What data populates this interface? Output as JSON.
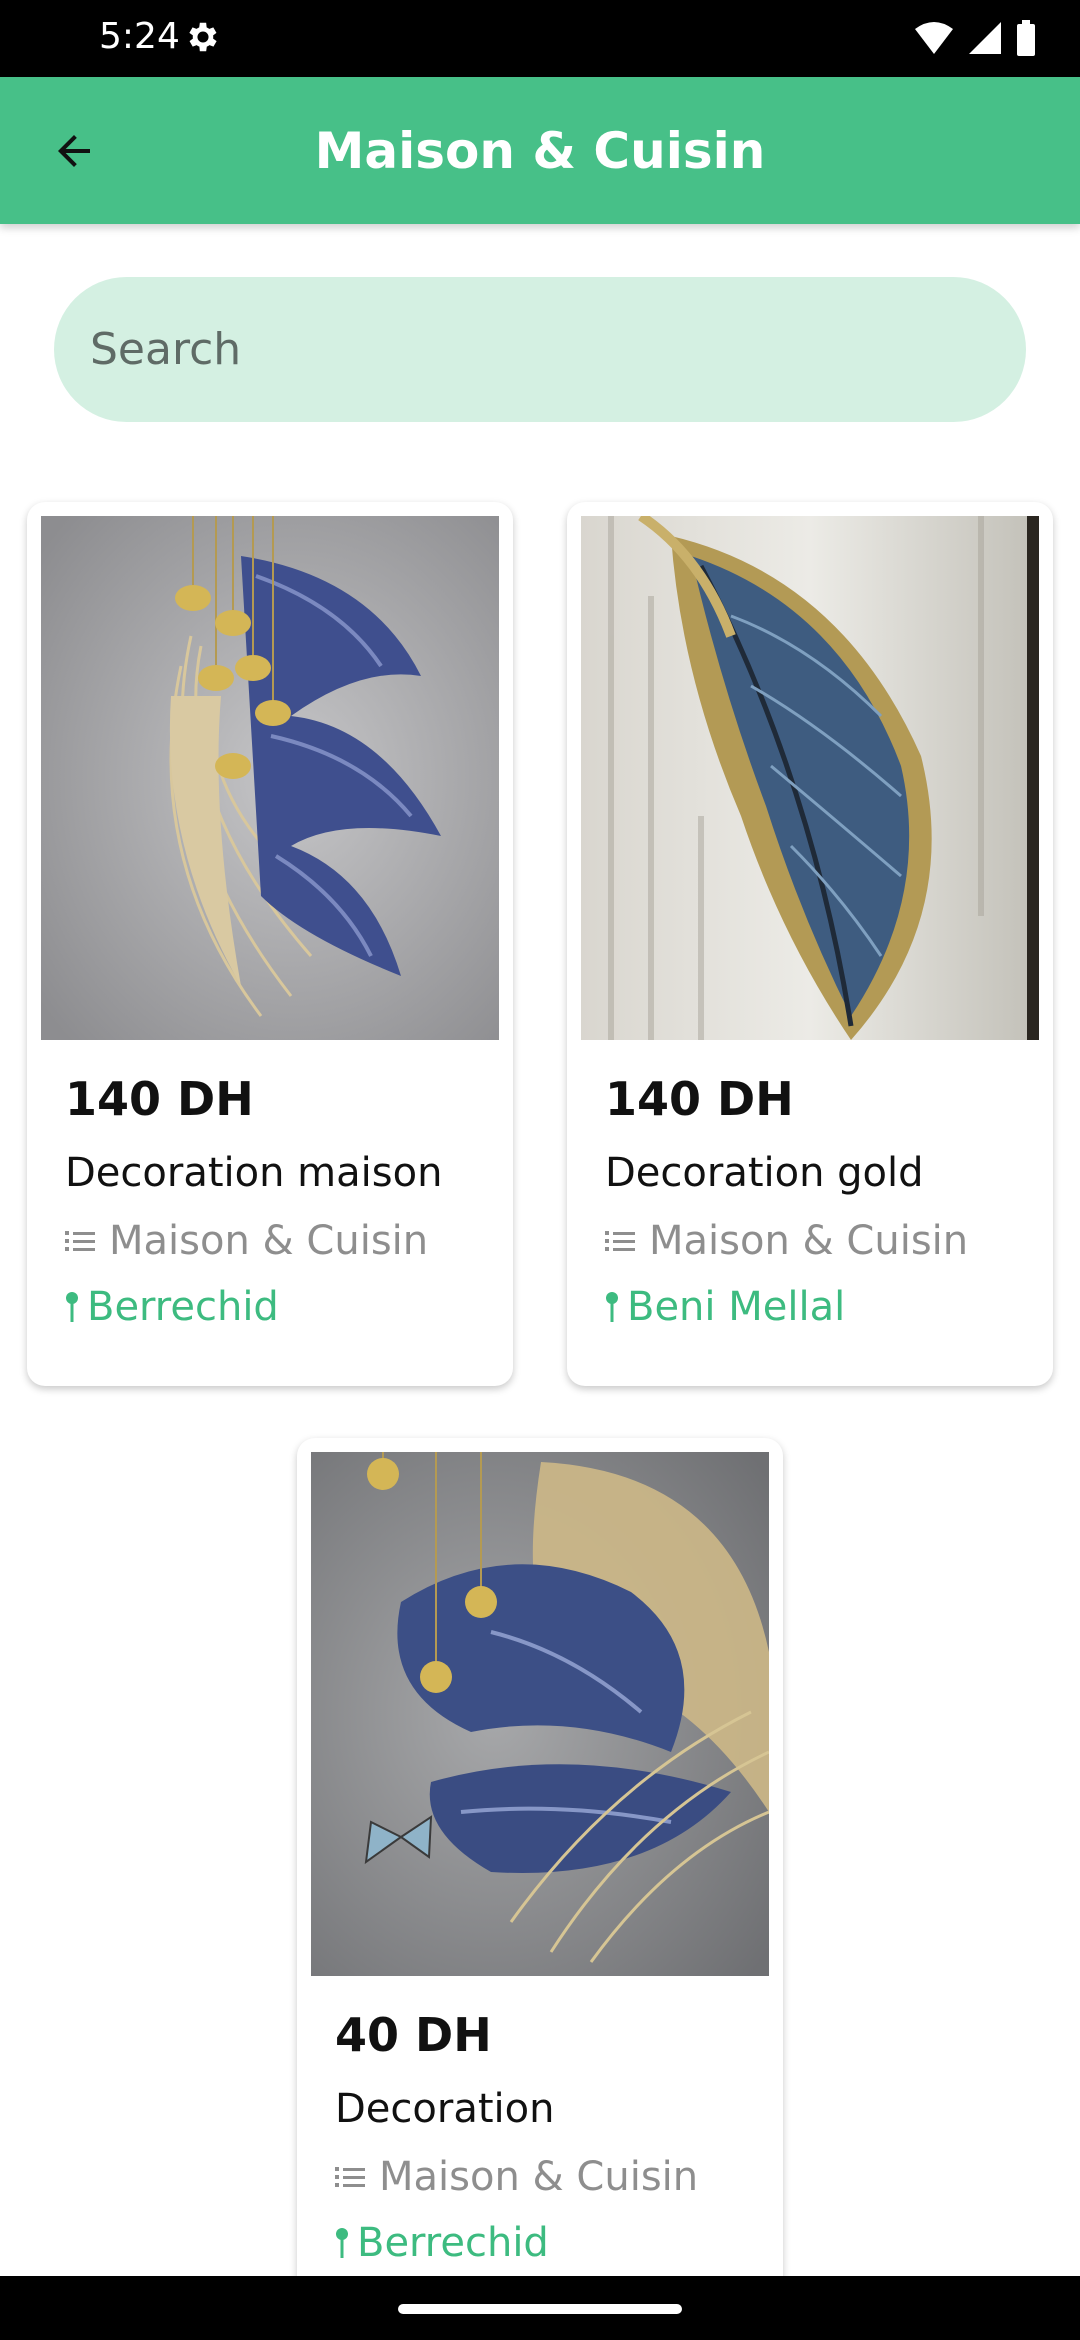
{
  "status_bar": {
    "time": "5:24"
  },
  "header": {
    "title": "Maison & Cuisin"
  },
  "search": {
    "placeholder": "Search"
  },
  "products": [
    {
      "price": "140 DH",
      "name": "Decoration maison",
      "category": "Maison & Cuisin",
      "location": "Berrechid"
    },
    {
      "price": "140 DH",
      "name": "Decoration gold",
      "category": "Maison & Cuisin",
      "location": "Beni Mellal"
    },
    {
      "price": "40 DH",
      "name": "Decoration",
      "category": "Maison & Cuisin",
      "location": "Berrechid"
    }
  ],
  "colors": {
    "accent": "#47c088",
    "search_bg": "#d4f0e2",
    "location": "#3dbb80"
  }
}
